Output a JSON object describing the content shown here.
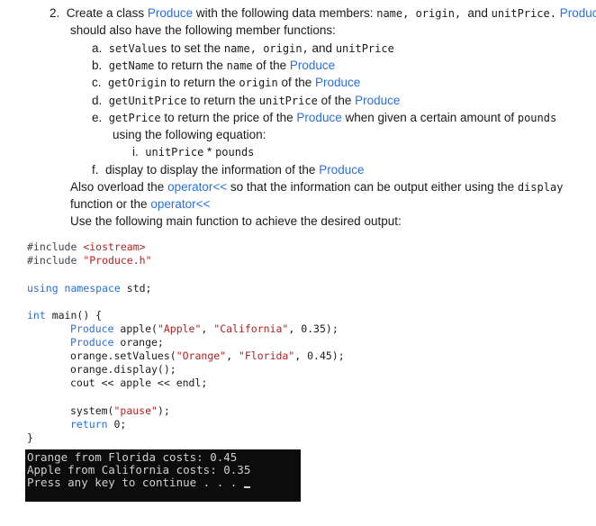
{
  "question": {
    "number": "2.",
    "intro_a": "Create a class ",
    "intro_cls": "Produce",
    "intro_b": " with the following data members: ",
    "intro_members": "name, origin, ",
    "intro_and": "and ",
    "intro_unit": "unitPrice.",
    "intro_cls2": "Produce",
    "intro_line2": "should also have the following member functions:",
    "items": [
      {
        "letter": "a.",
        "fn": "setValues",
        "text": " to set the ",
        "m1": "name, origin,",
        "and": " and ",
        "m2": "unitPrice"
      },
      {
        "letter": "b.",
        "fn": "getName",
        "text": " to return the ",
        "m1": "name",
        "of": " of the ",
        "cls": "Produce"
      },
      {
        "letter": "c.",
        "fn": "getOrigin",
        "text": " to return the ",
        "m1": "origin",
        "of": " of the ",
        "cls": "Produce"
      },
      {
        "letter": "d.",
        "fn": "getUnitPrice",
        "text": " to return the ",
        "m1": "unitPrice",
        "of": " of the ",
        "cls": "Produce"
      },
      {
        "letter": "e.",
        "fn": "getPrice",
        "text": " to return the price of the ",
        "cls": "Produce",
        "rest": " when given a certain amount of ",
        "m1": "pounds"
      }
    ],
    "eq_intro": "using the following equation:",
    "eq_num": "i.",
    "eq_a": "unitPrice",
    "eq_op": " * ",
    "eq_b": "pounds",
    "item_f": {
      "letter": "f.",
      "fn": "display",
      "text": " to display the information of the ",
      "cls": "Produce"
    },
    "overload_a": "Also overload the ",
    "overload_op": "operator<<",
    "overload_b": " so that the information can be output either using the ",
    "overload_fn": "display",
    "overload_c": "function or the ",
    "overload_op2": "operator<<",
    "main_line": "Use the following main function to achieve the desired output:"
  },
  "code": {
    "inc1_kw": "#include",
    "inc1_val": "<iostream>",
    "inc2_kw": "#include",
    "inc2_val": "\"Produce.h\"",
    "using_kw": "using namespace",
    "using_rest": " std;",
    "main_kw": "int",
    "main_rest": " main() {",
    "l1_cls": "Produce",
    "l1_a": " apple(",
    "l1_s1": "\"Apple\"",
    "l1_c1": ", ",
    "l1_s2": "\"California\"",
    "l1_b": ", 0.35);",
    "l2_cls": "Produce",
    "l2_a": " orange;",
    "l3_a": "orange.setValues(",
    "l3_s1": "\"Orange\"",
    "l3_c1": ", ",
    "l3_s2": "\"Florida\"",
    "l3_b": ", 0.45);",
    "l4": "orange.display();",
    "l5": "cout << apple << endl;",
    "l6_a": "system(",
    "l6_s": "\"pause\"",
    "l6_b": ");",
    "l7_kw": "return",
    "l7_rest": " 0;",
    "close": "}"
  },
  "terminal": {
    "lines": [
      "Orange from Florida costs: 0.45",
      "Apple from California costs: 0.35",
      "Press any key to continue . . ."
    ]
  }
}
